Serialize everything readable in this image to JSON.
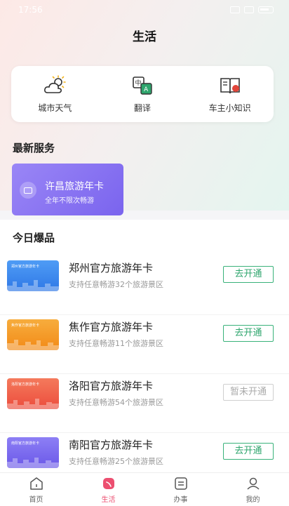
{
  "status_bar": {
    "time": "17:56"
  },
  "page": {
    "title": "生活"
  },
  "quick_actions": [
    {
      "label": "城市天气",
      "icon": "weather-icon"
    },
    {
      "label": "翻译",
      "icon": "translate-icon"
    },
    {
      "label": "车主小知识",
      "icon": "book-icon"
    }
  ],
  "sections": {
    "latest_services": "最新服务",
    "today_hot": "今日爆品"
  },
  "service_card": {
    "title": "许昌旅游年卡",
    "subtitle": "全年不限次畅游",
    "icon": "card-icon"
  },
  "products": [
    {
      "name": "郑州官方旅游年卡",
      "desc": "支持任意畅游32个旅游景区",
      "button": "去开通",
      "enabled": true,
      "thumb_tag": "郑州官方旅游年卡",
      "thumb_color": "#3f8ff0"
    },
    {
      "name": "焦作官方旅游年卡",
      "desc": "支持任意畅游11个旅游景区",
      "button": "去开通",
      "enabled": true,
      "thumb_tag": "焦作官方旅游年卡",
      "thumb_color": "#f59a23"
    },
    {
      "name": "洛阳官方旅游年卡",
      "desc": "支持任意畅游54个旅游景区",
      "button": "暂未开通",
      "enabled": false,
      "thumb_tag": "洛阳官方旅游年卡",
      "thumb_color": "#f0604a"
    },
    {
      "name": "南阳官方旅游年卡",
      "desc": "支持任意畅游25个旅游景区",
      "button": "去开通",
      "enabled": true,
      "thumb_tag": "南阳官方旅游年卡",
      "thumb_color": "#7c6cf0"
    }
  ],
  "tab_bar": [
    {
      "label": "首页",
      "icon": "home-icon",
      "active": false
    },
    {
      "label": "生活",
      "icon": "life-icon",
      "active": true
    },
    {
      "label": "办事",
      "icon": "services-icon",
      "active": false
    },
    {
      "label": "我的",
      "icon": "profile-icon",
      "active": false
    }
  ],
  "colors": {
    "accent_green": "#2ea56d",
    "accent_pink": "#ec4f70",
    "service_purple": "#8a74f2"
  }
}
